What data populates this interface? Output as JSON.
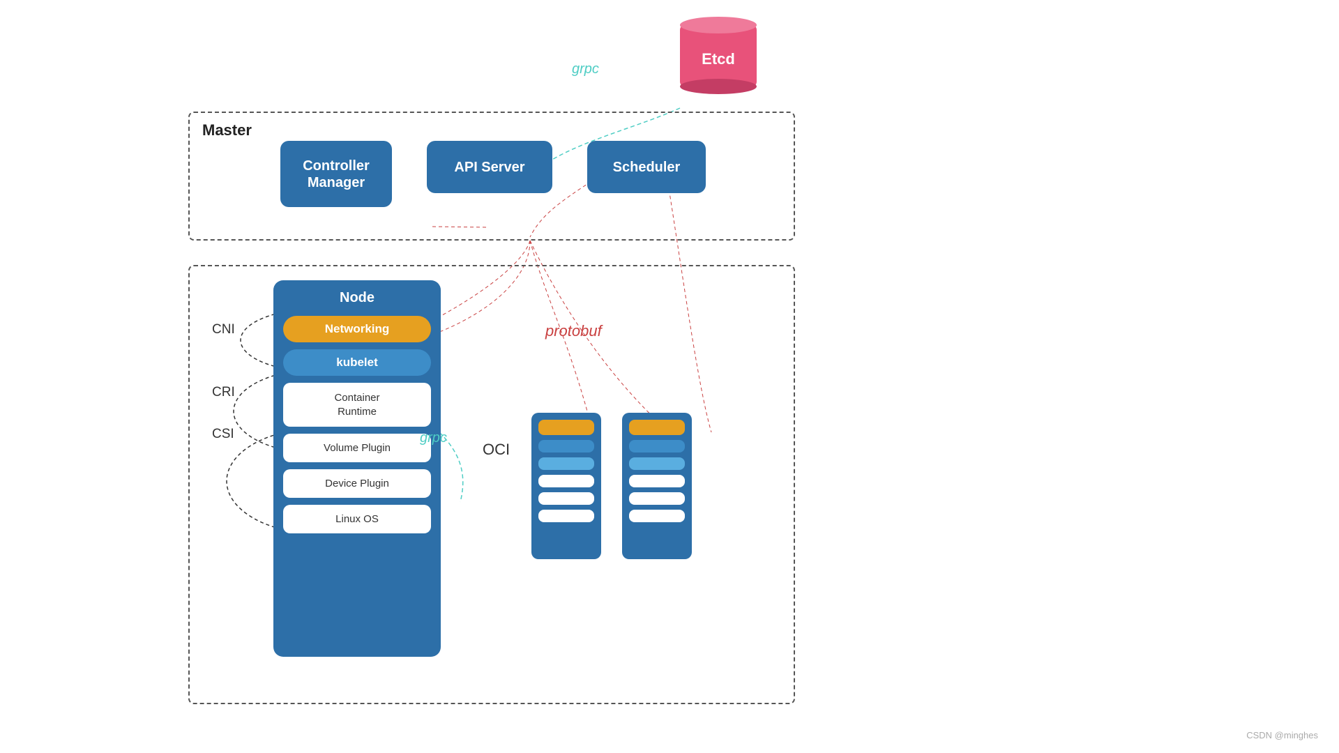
{
  "etcd": {
    "label": "Etcd"
  },
  "master": {
    "label": "Master",
    "controller_manager": "Controller\nManager",
    "api_server": "API Server",
    "scheduler": "Scheduler"
  },
  "node": {
    "label": "Node",
    "networking": "Networking",
    "kubelet": "kubelet",
    "container_runtime": "Container\nRuntime",
    "volume_plugin": "Volume Plugin",
    "device_plugin": "Device Plugin",
    "linux_os": "Linux OS"
  },
  "labels": {
    "cni": "CNI",
    "cri": "CRI",
    "csi": "CSI",
    "oci": "OCI",
    "grpc_top": "grpc",
    "grpc_bottom": "grpc",
    "protobuf": "protobuf"
  },
  "watermark": "CSDN @minghes"
}
